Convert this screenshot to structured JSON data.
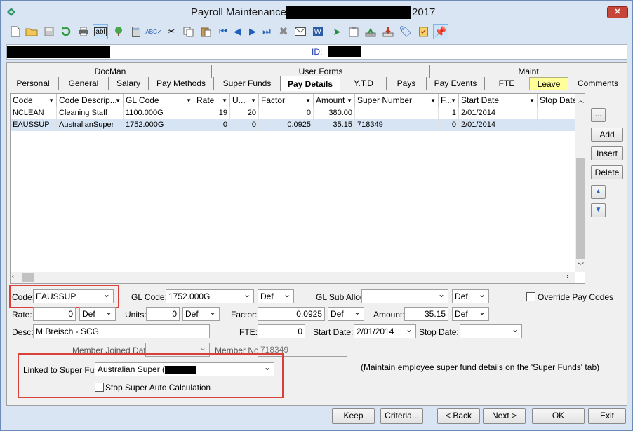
{
  "window": {
    "title_left": "Payroll Maintenance",
    "title_right": "2017",
    "close_glyph": "✕"
  },
  "toolbar": {
    "icons": [
      "new-icon",
      "open-icon",
      "save-icon",
      "refresh-icon",
      "print-icon",
      "abl-icon",
      "tree-icon",
      "calculator-icon",
      "spellcheck-icon",
      "cut-icon",
      "copy-icon",
      "paste-icon",
      "first-record-icon",
      "previous-record-icon",
      "next-record-icon",
      "last-record-icon",
      "delete-icon",
      "email-icon",
      "word-icon",
      "export-icon",
      "clipboard-icon",
      "download-icon",
      "stamp-icon",
      "tag-icon",
      "checklist-icon",
      "pin-icon"
    ],
    "abl_label": "abl"
  },
  "idbar": {
    "id_label": "ID:"
  },
  "tabs_top": [
    "DocMan",
    "User Forms",
    "Maint"
  ],
  "tabs": [
    "Personal",
    "General",
    "Salary",
    "Pay Methods",
    "Super Funds",
    "Pay Details",
    "Y.T.D",
    "Pays",
    "Pay Events",
    "FTE",
    "Leave",
    "Comments"
  ],
  "active_tab": "Pay Details",
  "grid": {
    "columns": [
      "Code",
      "Code Descrip...",
      "GL Code",
      "Rate",
      "U...",
      "Factor",
      "Amount",
      "Super Number",
      "F...",
      "Start Date",
      "Stop Date"
    ],
    "rows": [
      [
        "NCLEAN",
        "Cleaning Staff",
        "1100.000G",
        "19",
        "20",
        "0",
        "380.00",
        "",
        "1",
        "2/01/2014",
        ""
      ],
      [
        "EAUSSUP",
        "AustralianSuper",
        "1752.000G",
        "0",
        "0",
        "0.0925",
        "35.15",
        "718349",
        "0",
        "2/01/2014",
        ""
      ]
    ],
    "selected_row": 1
  },
  "side_buttons": {
    "more": "...",
    "add": "Add",
    "insert": "Insert",
    "delete": "Delete"
  },
  "form": {
    "code_label": "Code:",
    "code_value": "EAUSSUP",
    "gl_code_label": "GL Code:",
    "gl_code_value": "1752.000G",
    "gl_def": "Def",
    "gl_sub_label": "GL Sub Alloc:",
    "gl_sub_value": "",
    "gl_sub_def": "Def",
    "override_label": "Override Pay Codes",
    "rate_label": "Rate:",
    "rate_value": "0",
    "rate_def": "Def",
    "units_label": "Units:",
    "units_value": "0",
    "units_def": "Def",
    "factor_label": "Factor:",
    "factor_value": "0.0925",
    "factor_def": "Def",
    "amount_label": "Amount:",
    "amount_value": "35.15",
    "amount_def": "Def",
    "desc_label": "Desc:",
    "desc_value": "M Breisch - SCG",
    "fte_label": "FTE:",
    "fte_value": "0",
    "start_label": "Start Date:",
    "start_value": "2/01/2014",
    "stop_label": "Stop Date:",
    "stop_value": "",
    "member_joined_label": "Member Joined Date:",
    "member_joined_value": "",
    "member_no_label": "Member No:",
    "member_no_value": "718349",
    "linked_label": "Linked to Super Fund:",
    "linked_value": "Australian Super (",
    "stop_super_label": "Stop Super Auto Calculation",
    "note": "(Maintain employee super fund details on the 'Super Funds' tab)"
  },
  "footer": {
    "keep": "Keep",
    "criteria": "Criteria...",
    "back": "< Back",
    "next": "Next >",
    "ok": "OK",
    "exit": "Exit"
  },
  "colors": {
    "window_bg": "#dae5f3",
    "active_tab_bg": "#ffffff",
    "leave_tab_bg": "#ffff99",
    "highlight_box": "#d8403a",
    "selected_row": "#d6e4f3"
  }
}
